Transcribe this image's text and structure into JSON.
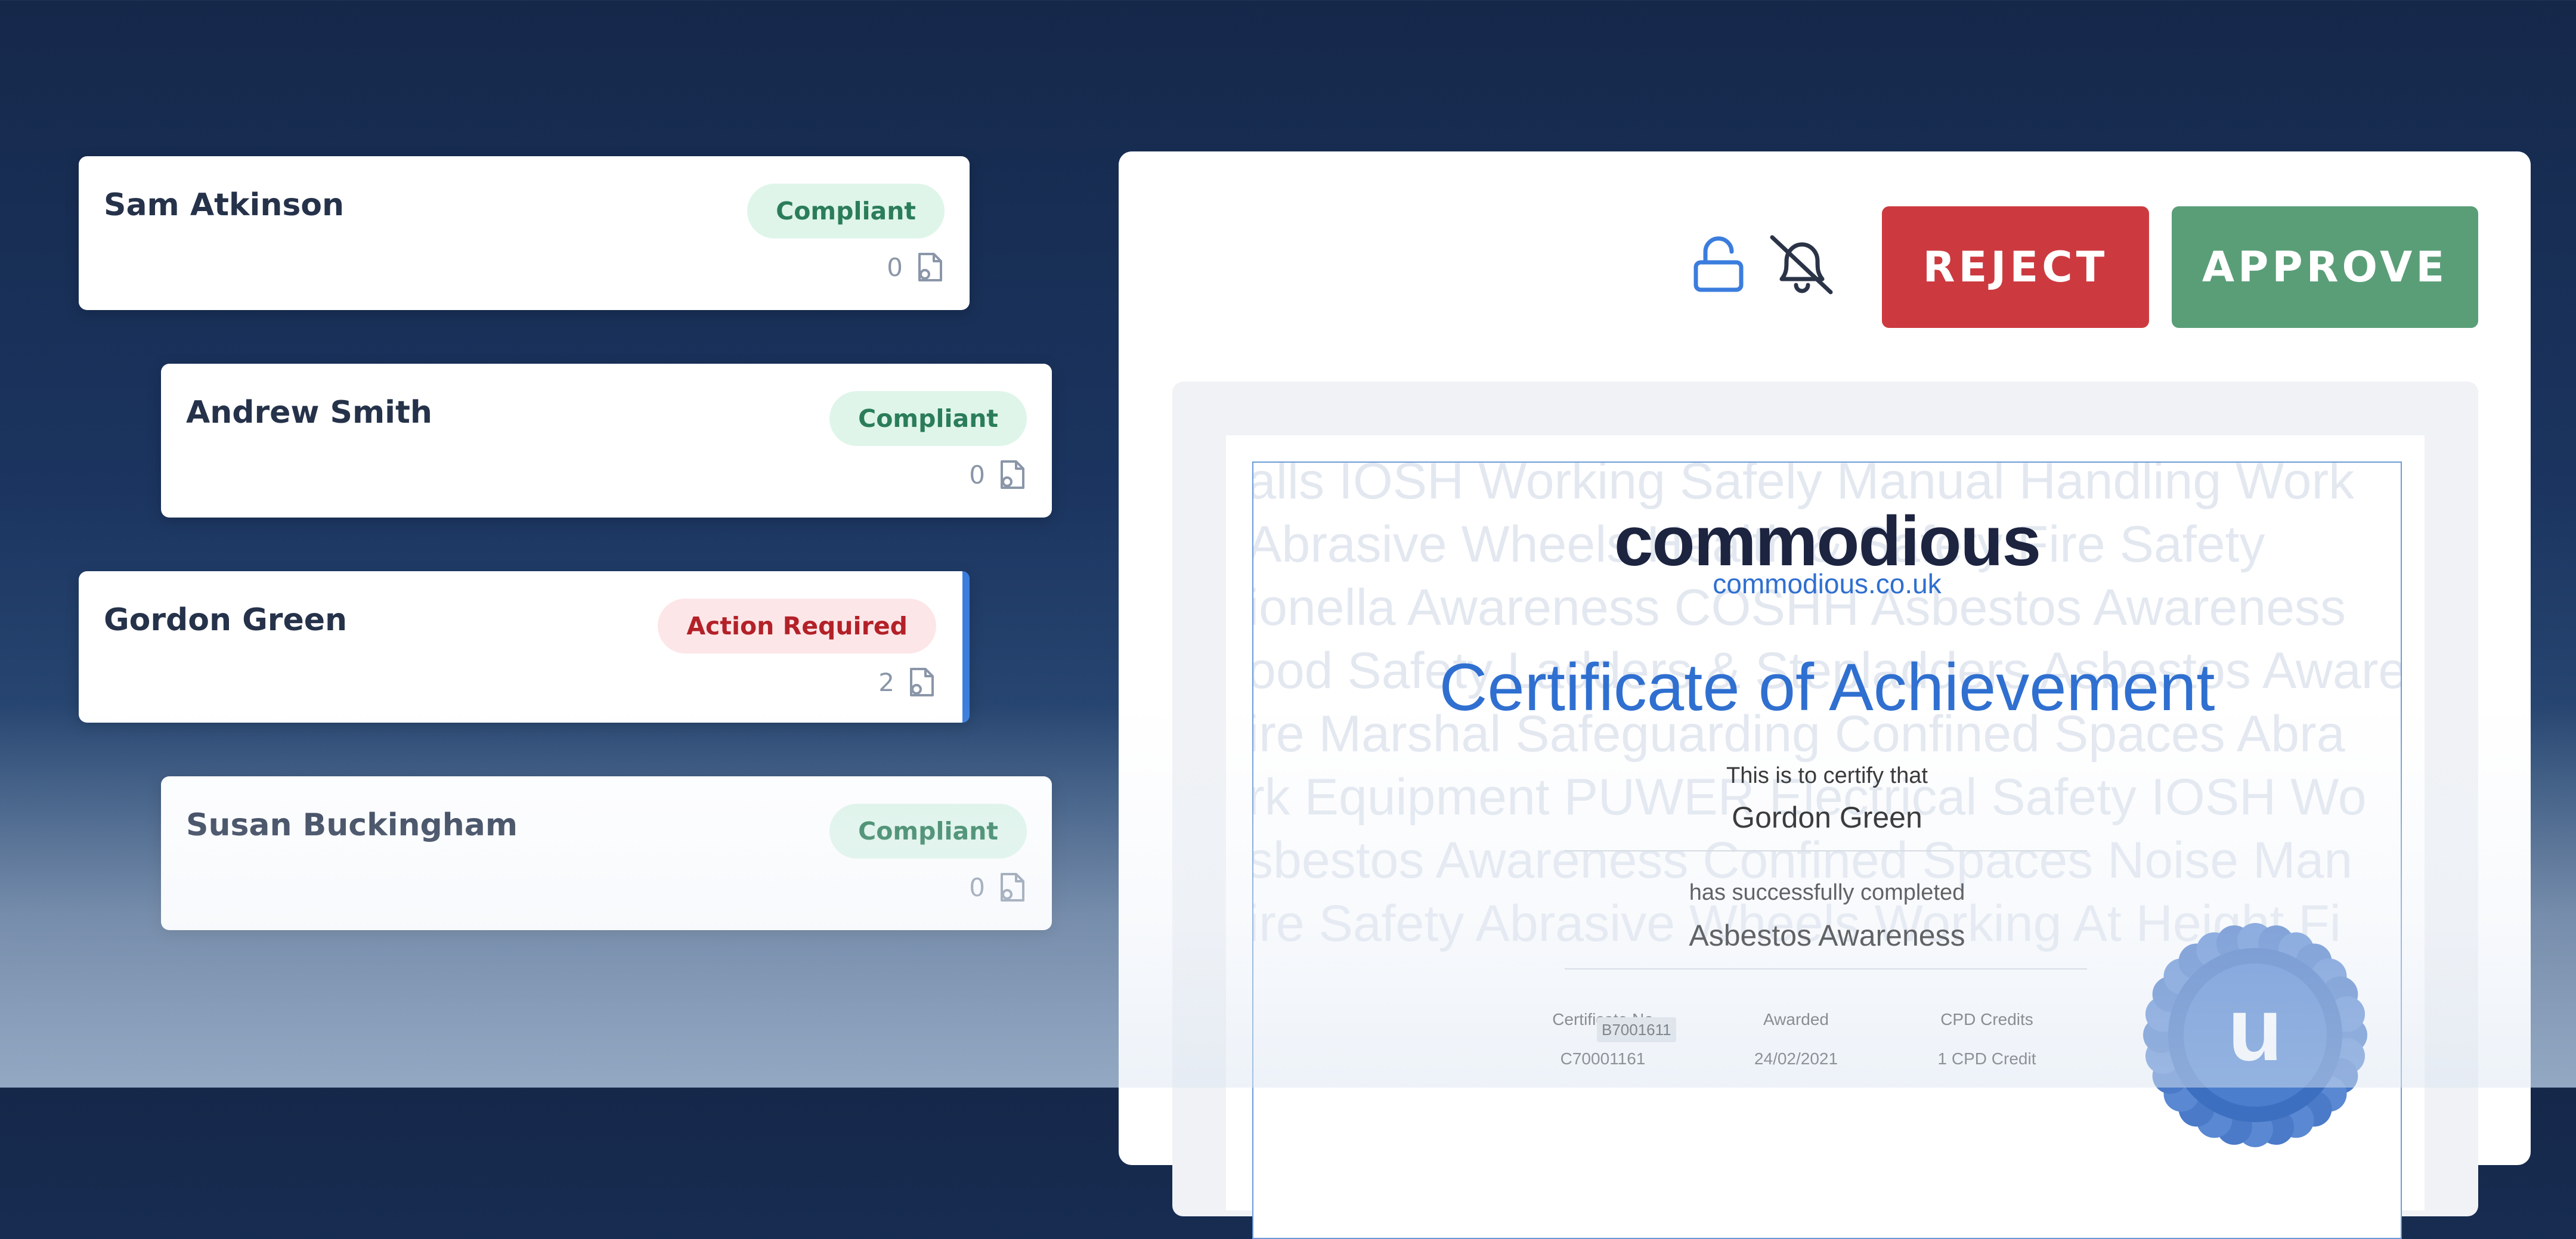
{
  "people": [
    {
      "name": "Sam Atkinson",
      "status": "Compliant",
      "count": "0"
    },
    {
      "name": "Andrew Smith",
      "status": "Compliant",
      "count": "0"
    },
    {
      "name": "Gordon Green",
      "status": "Action Required",
      "count": "2"
    },
    {
      "name": "Susan Buckingham",
      "status": "Compliant",
      "count": "0"
    }
  ],
  "toolbar": {
    "reject_label": "REJECT",
    "approve_label": "APPROVE",
    "icons": [
      "unlock-icon",
      "notifications-off-icon"
    ]
  },
  "certificate": {
    "brand": "commodious",
    "url": "commodious.co.uk",
    "title_part1": "Certificate of ",
    "title_part2": "Achievement",
    "certify_text": "This is to certify that",
    "recipient": "Gordon Green",
    "completed_text": "has successfully completed",
    "course": "Asbestos Awareness",
    "meta_labels": {
      "certificate_no": "Certificate No",
      "awarded": "Awarded",
      "cpd": "CPD Credits"
    },
    "meta_values": {
      "certificate_no": "C70001161",
      "awarded": "24/02/2021",
      "cpd": "1 CPD Credit"
    },
    "tooltip": "B7001611",
    "seal_letter": "u",
    "watermark_lines": [
      "alls IOSH Working Safely Manual Handling Work",
      "Abrasive Wheels Health & Safety Fire Safety",
      "ionella Awareness COSHH Asbestos Awareness",
      "ood Safety Ladders & Stepladders Asbestos Aware",
      "ire Marshal Safeguarding Confined Spaces Abra",
      "rk Equipment PUWER Electrical Safety IOSH Wo",
      "sbestos Awareness Confined Spaces Noise Man",
      "ire Safety Abrasive Wheels Working At Height Fi"
    ]
  },
  "colors": {
    "compliant_bg": "#dff5ea",
    "compliant_text": "#2b7d59",
    "action_bg": "#fde6e8",
    "action_text": "#b32128",
    "reject": "#cc3a3f",
    "approve": "#5a9e78",
    "accent": "#3b7ddd"
  }
}
